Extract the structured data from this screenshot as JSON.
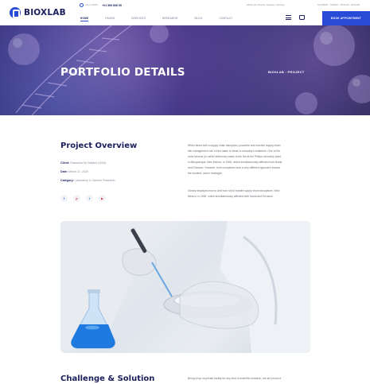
{
  "brand": {
    "name": "BIOXLAB",
    "accent": "#2a4bd7",
    "dark": "#1a1f5c"
  },
  "topbar": {
    "phone_label": "CALL TODAY:",
    "phone": "+01 569 896 55",
    "address": "Edinburgh, Florence, Sinsheim, Germany",
    "hours": "SATURDAY - SUNDAY : 09:00 AM - 05:00 PM"
  },
  "nav": {
    "items": [
      {
        "label": "HOME"
      },
      {
        "label": "PAGES"
      },
      {
        "label": "SERVICES"
      },
      {
        "label": "RESEARCH"
      },
      {
        "label": "BLOG"
      },
      {
        "label": "CONTACT"
      }
    ],
    "cta": "BOOK APPOINTMENT"
  },
  "hero": {
    "title": "PORTFOLIO DETAILS",
    "breadcrumb": "BIOXLAB : PROJECT"
  },
  "overview": {
    "title": "Project Overview",
    "client_label": "Client:",
    "client_value": "Pascalina De Bellaire (USA)",
    "date_label": "Date:",
    "date_value": "March 21, 2020",
    "category_label": "Category:",
    "category_value": "Laboratory & Science Research",
    "socials": [
      {
        "name": "facebook",
        "glyph": "f",
        "color": "#3b5bdb"
      },
      {
        "name": "pinterest",
        "glyph": "p",
        "color": "#e03131"
      },
      {
        "name": "twitter",
        "glyph": "t",
        "color": "#1c9bd6"
      },
      {
        "name": "youtube",
        "glyph": "▶",
        "color": "#e03131"
      }
    ],
    "para1_lines": [
      "When faced with a supply chain disruption, proactive and reactive supply chain",
      "risk management can in fact make to break a company's existence. One of the",
      "most famous (or rather infamous) cases is the fire at the Philips microchip plant",
      "in Albuquerque, New Mexico, in 2000, which simultaneously affected both Nokia",
      "and Ericsson. However, both companies took a very different approach toward",
      "the incident, and in hindsight,."
    ],
    "para2_lines": [
      "Clearly displayed how to and how not to handle supply chain disruptions. New",
      "Mexico, in 2000, which simultaneously affected both Nokia and Ericsson"
    ]
  },
  "challenge": {
    "title": "Challenge & Solution",
    "text": "Being a top us private facility for any kind of  scientific research, we are proud of"
  }
}
